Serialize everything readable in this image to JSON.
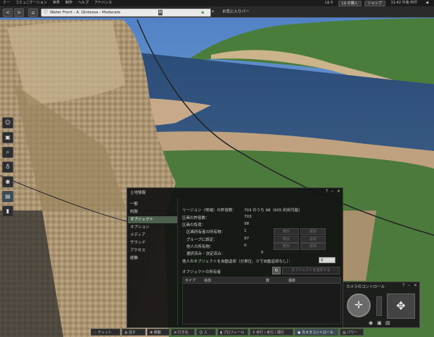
{
  "menubar": {
    "items": [
      "ミー",
      "コミュニケーション",
      "世界",
      "制作",
      "ヘルプ",
      "アドバンス"
    ],
    "balance": "L$ 0",
    "buy_button": "L$ の購入",
    "shop_button": "ショップ",
    "time": "11:42 午後 PDT"
  },
  "navbar": {
    "back_icon": "<",
    "forward_icon": ">",
    "home_icon": "⌂",
    "location": "Water Front - A. Qintessa - Moderate",
    "rating_badge": "M",
    "favorites_label": "お気に入りバー"
  },
  "left_toolbar": {
    "icons": [
      "people-icon",
      "inventory-icon",
      "search-icon",
      "destinations-icon",
      "mini-map-icon",
      "snapshot-icon",
      "profile-icon"
    ]
  },
  "land_panel": {
    "title": "土地情報",
    "controls": {
      "help": "?",
      "minimize": "–",
      "close": "×"
    },
    "tabs": [
      "一般",
      "約款",
      "オブジェクト",
      "オプション",
      "メディア",
      "サウンド",
      "アクセス",
      "経験"
    ],
    "active_tab": "オブジェクト",
    "region_support": "リージョン（地域）の許容数：",
    "region_support_value": "703 のうち 98（605 利用可能）",
    "parcel_support": "区画の許容数：",
    "parcel_support_value": "703",
    "objects_on_parcel": "区画の負荷：",
    "objects_on_parcel_value": "98",
    "owned_by_owner": "区画所有者の所有物：",
    "owned_by_owner_value": "1",
    "set_to_group": "グループに設定：",
    "set_to_group_value": "97",
    "owned_by_others": "他人の所有物：",
    "owned_by_others_value": "0",
    "selected_sitting": "選択済み・決定済み：",
    "selected_sitting_value": "0",
    "show_button": "表示",
    "return_button": "返却",
    "autoreturn_label": "他人のオブジェクトを自動返却（分単位、０で自動返却なし）：",
    "autoreturn_value": "0",
    "object_owners_label": "オブジェクトの所有者",
    "refresh_button": "オブジェクトを返却する",
    "table_headers": [
      "タイプ",
      "名前",
      "数",
      "最新"
    ]
  },
  "bottom_bar": {
    "buttons": [
      "チャット",
      "話す",
      "移動",
      "行き先",
      "人",
      "プロフィール",
      "歩行 / 走行 / 飛行",
      "カメラコントロール",
      "パワー"
    ]
  },
  "camera_panel": {
    "title": "カメラのコントロール",
    "help": "?",
    "minimize": "–",
    "close": "×"
  }
}
